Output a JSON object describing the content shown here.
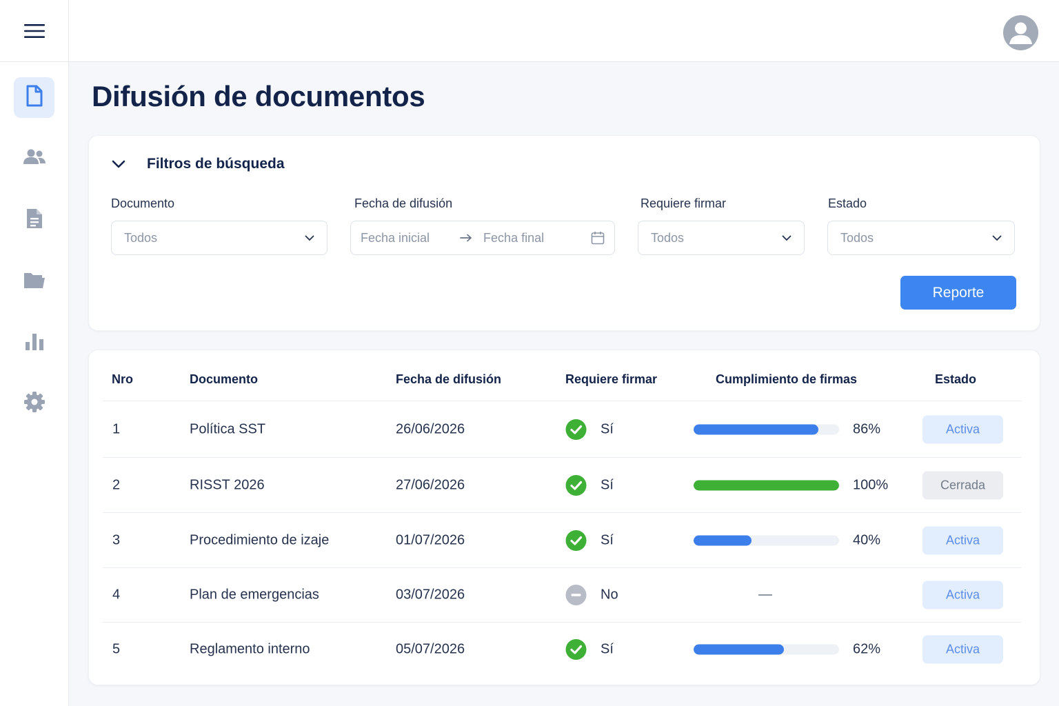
{
  "header": {
    "menu_icon": "hamburger-menu-icon",
    "avatar_icon": "user-avatar-icon"
  },
  "sidebar": {
    "items": [
      {
        "icon": "document-outline-icon",
        "active": true
      },
      {
        "icon": "users-icon",
        "active": false
      },
      {
        "icon": "document-text-icon",
        "active": false
      },
      {
        "icon": "folder-icon",
        "active": false
      },
      {
        "icon": "bar-chart-icon",
        "active": false
      },
      {
        "icon": "gear-icon",
        "active": false
      }
    ]
  },
  "page": {
    "title": "Difusión de documentos"
  },
  "filters": {
    "title": "Filtros de búsqueda",
    "documento": {
      "label": "Documento",
      "value": "Todos"
    },
    "fecha": {
      "label": "Fecha de difusión",
      "start_placeholder": "Fecha inicial",
      "end_placeholder": "Fecha final"
    },
    "firmar": {
      "label": "Requiere firmar",
      "value": "Todos"
    },
    "estado": {
      "label": "Estado",
      "value": "Todos"
    },
    "report_button": "Reporte"
  },
  "table": {
    "columns": {
      "nro": "Nro",
      "documento": "Documento",
      "fecha": "Fecha de difusión",
      "firmar": "Requiere firmar",
      "cumplimiento": "Cumplimiento de firmas",
      "estado": "Estado"
    },
    "rows": [
      {
        "nro": "1",
        "documento": "Política SST",
        "fecha": "26/06/2026",
        "firmar": "Sí",
        "requires": true,
        "progress": 0.86,
        "pct": "86%",
        "bar_color": "blue",
        "estado": "Activa",
        "estado_type": "active"
      },
      {
        "nro": "2",
        "documento": "RISST 2026",
        "fecha": "27/06/2026",
        "firmar": "Sí",
        "requires": true,
        "progress": 1.0,
        "pct": "100%",
        "bar_color": "green",
        "estado": "Cerrada",
        "estado_type": "closed"
      },
      {
        "nro": "3",
        "documento": "Procedimiento de izaje",
        "fecha": "01/07/2026",
        "firmar": "Sí",
        "requires": true,
        "progress": 0.4,
        "pct": "40%",
        "bar_color": "blue",
        "estado": "Activa",
        "estado_type": "active"
      },
      {
        "nro": "4",
        "documento": "Plan de emergencias",
        "fecha": "03/07/2026",
        "firmar": "No",
        "requires": false,
        "progress": null,
        "pct": "—",
        "bar_color": "",
        "estado": "Activa",
        "estado_type": "active"
      },
      {
        "nro": "5",
        "documento": "Reglamento interno",
        "fecha": "05/07/2026",
        "firmar": "Sí",
        "requires": true,
        "progress": 0.62,
        "pct": "62%",
        "bar_color": "blue",
        "estado": "Activa",
        "estado_type": "active"
      }
    ]
  },
  "colors": {
    "accent": "#3d85f0",
    "success": "#3eb036",
    "title": "#13234a"
  }
}
